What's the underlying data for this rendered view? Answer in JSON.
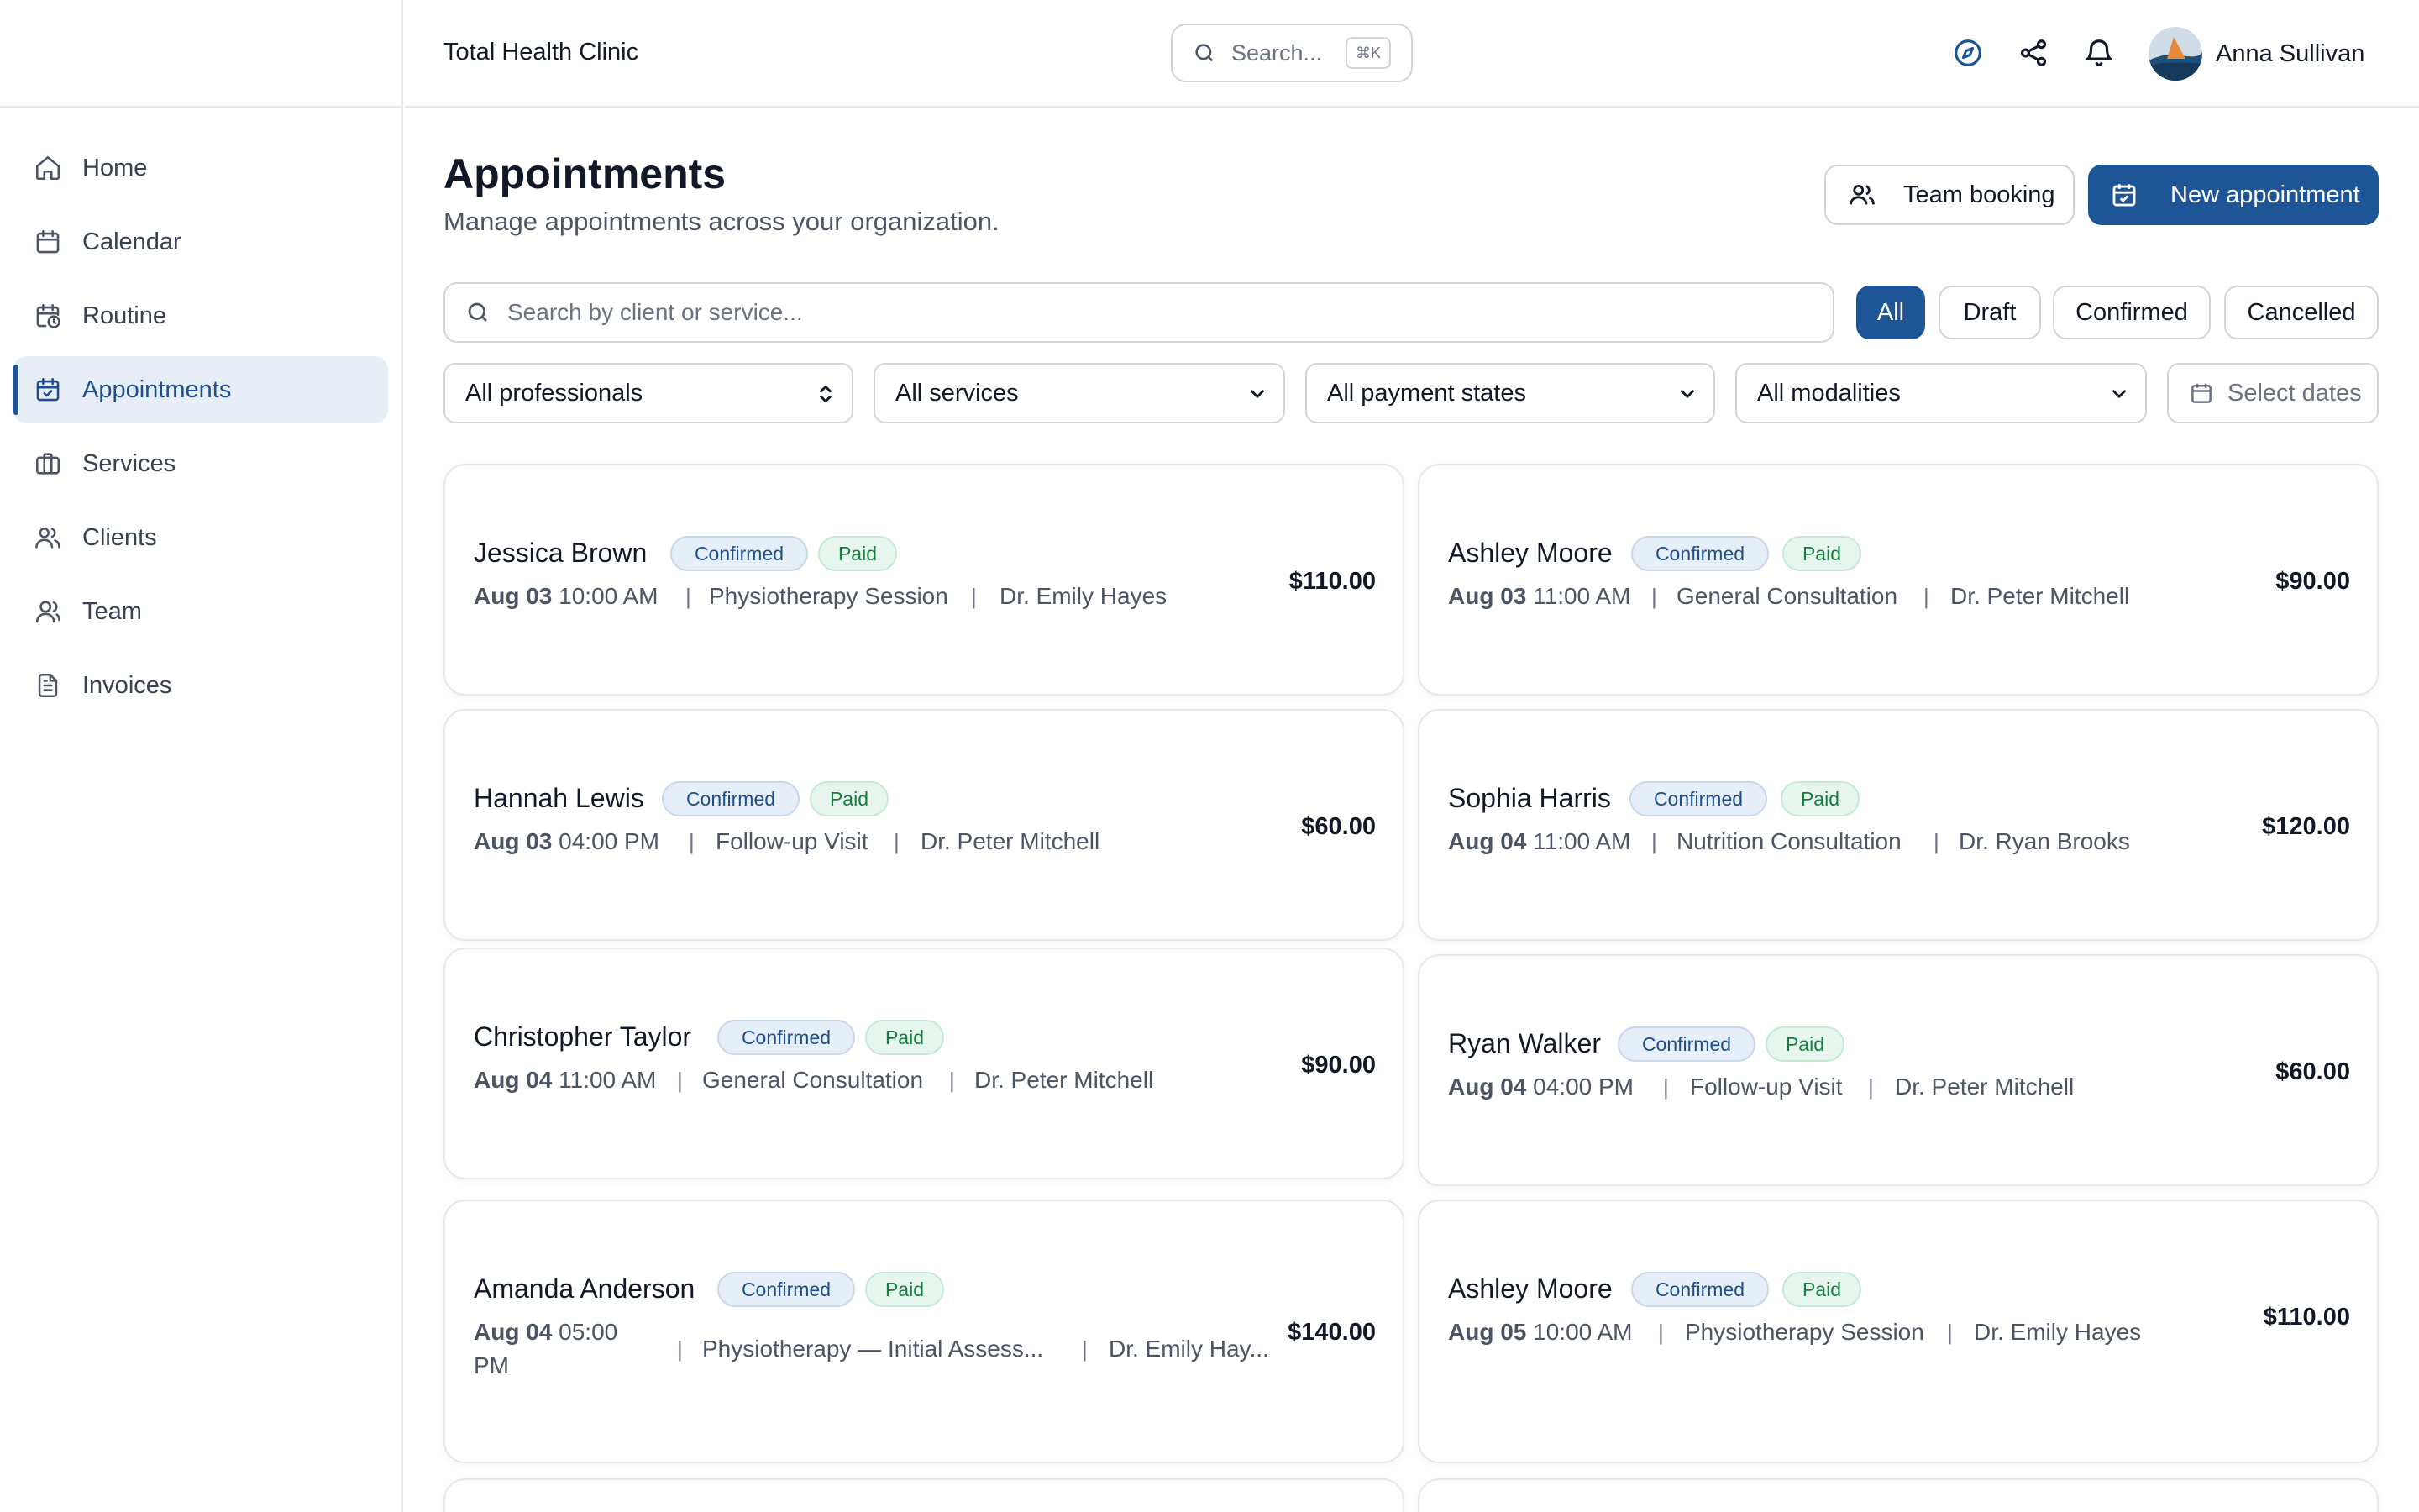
{
  "sidebar": {
    "items": [
      {
        "label": "Home"
      },
      {
        "label": "Calendar"
      },
      {
        "label": "Routine"
      },
      {
        "label": "Appointments",
        "active": true
      },
      {
        "label": "Services"
      },
      {
        "label": "Clients"
      },
      {
        "label": "Team"
      },
      {
        "label": "Invoices"
      }
    ]
  },
  "header": {
    "clinic_name": "Total Health Clinic",
    "search_placeholder": "Search...",
    "search_shortcut": "⌘K",
    "user_name": "Anna Sullivan"
  },
  "page": {
    "title": "Appointments",
    "subtitle": "Manage appointments across your organization.",
    "team_booking_label": "Team booking",
    "new_appointment_label": "New appointment"
  },
  "filters": {
    "search_placeholder": "Search by client or service...",
    "status_tabs": [
      "All",
      "Draft",
      "Confirmed",
      "Cancelled"
    ],
    "active_status": "All",
    "professionals": "All professionals",
    "services": "All services",
    "payment_states": "All payment states",
    "modalities": "All modalities",
    "dates": "Select dates"
  },
  "colors": {
    "accent": "#1d5597",
    "confirmed_bg": "#e6eef8",
    "paid_bg": "#e6f6ee"
  },
  "appointments": [
    {
      "client": "Jessica Brown",
      "status": "Confirmed",
      "payment": "Paid",
      "date": "Aug 03",
      "time": "10:00 AM",
      "service": "Physiotherapy Session",
      "professional": "Dr. Emily Hayes",
      "price": "$110.00"
    },
    {
      "client": "Ashley Moore",
      "status": "Confirmed",
      "payment": "Paid",
      "date": "Aug 03",
      "time": "11:00 AM",
      "service": "General Consultation",
      "professional": "Dr. Peter Mitchell",
      "price": "$90.00"
    },
    {
      "client": "Hannah Lewis",
      "status": "Confirmed",
      "payment": "Paid",
      "date": "Aug 03",
      "time": "04:00 PM",
      "service": "Follow-up Visit",
      "professional": "Dr. Peter Mitchell",
      "price": "$60.00"
    },
    {
      "client": "Sophia Harris",
      "status": "Confirmed",
      "payment": "Paid",
      "date": "Aug 04",
      "time": "11:00 AM",
      "service": "Nutrition Consultation",
      "professional": "Dr. Ryan Brooks",
      "price": "$120.00"
    },
    {
      "client": "Christopher Taylor",
      "status": "Confirmed",
      "payment": "Paid",
      "date": "Aug 04",
      "time": "11:00 AM",
      "service": "General Consultation",
      "professional": "Dr. Peter Mitchell",
      "price": "$90.00"
    },
    {
      "client": "Ryan Walker",
      "status": "Confirmed",
      "payment": "Paid",
      "date": "Aug 04",
      "time": "04:00 PM",
      "service": "Follow-up Visit",
      "professional": "Dr. Peter Mitchell",
      "price": "$60.00"
    },
    {
      "client": "Amanda Anderson",
      "status": "Confirmed",
      "payment": "Paid",
      "date": "Aug 04",
      "time_line1": "05:00",
      "time_line2": "PM",
      "service": "Physiotherapy — Initial Assess...",
      "professional": "Dr. Emily Hay...",
      "price": "$140.00"
    },
    {
      "client": "Ashley Moore",
      "status": "Confirmed",
      "payment": "Paid",
      "date": "Aug 05",
      "time": "10:00 AM",
      "service": "Physiotherapy Session",
      "professional": "Dr. Emily Hayes",
      "price": "$110.00"
    }
  ]
}
